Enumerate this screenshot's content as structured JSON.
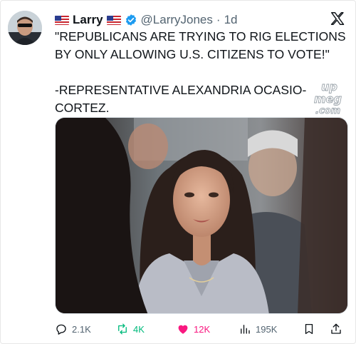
{
  "author": {
    "display_name": "Larry",
    "handle": "@LarryJones",
    "separator": "·",
    "time": "1d",
    "avatar_icon": "avatar-photo",
    "flag_icon": "us-flag-icon",
    "verified_color": "#1d9bf0"
  },
  "tweet": {
    "line1": "\"REPUBLICANS ARE TRYING TO RIG ELECTIONS BY ONLY ALLOWING U.S. CITIZENS TO VOTE!\"",
    "line2": "-REPRESENTATIVE ALEXANDRIA OCASIO-CORTEZ."
  },
  "watermark": {
    "line1": "up",
    "line2": "meg",
    "line3": ".com"
  },
  "actions": {
    "replies": "2.1K",
    "reposts": "4K",
    "likes": "12K",
    "views": "195K"
  },
  "colors": {
    "text": "#0f1419",
    "muted": "#536471",
    "repost": "#00ba7c",
    "like": "#f91880"
  }
}
